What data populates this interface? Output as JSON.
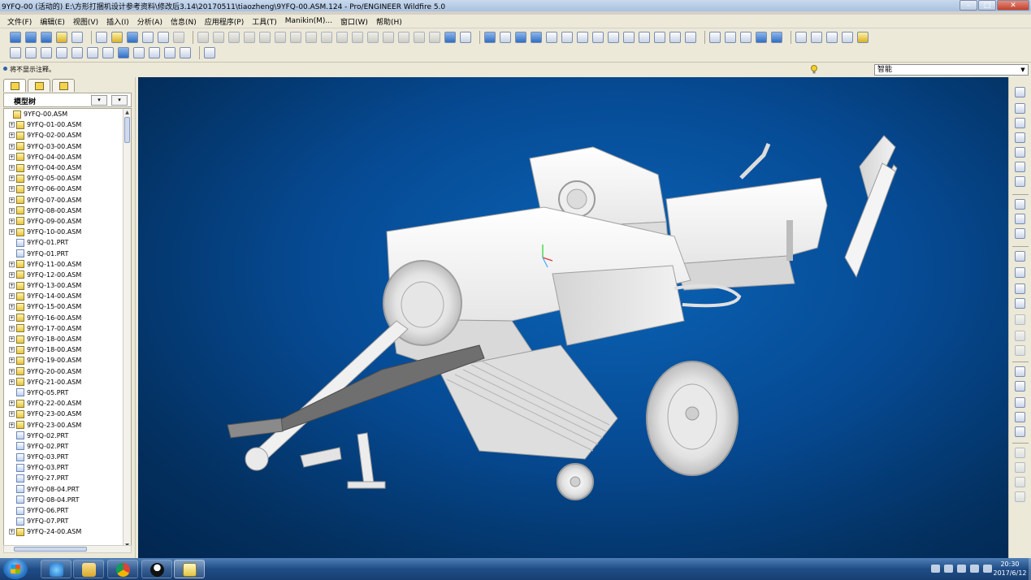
{
  "window": {
    "title": "9YFQ-00 (活动的) E:\\方形打捆机设计参考资料\\修改后3.14\\20170511\\tiaozheng\\9YFQ-00.ASM.124 - Pro/ENGINEER Wildfire 5.0",
    "minimize_glyph": "–",
    "maximize_glyph": "□",
    "close_glyph": "✕"
  },
  "menu": [
    "文件(F)",
    "编辑(E)",
    "视图(V)",
    "插入(I)",
    "分析(A)",
    "信息(N)",
    "应用程序(P)",
    "工具(T)",
    "Manikin(M)...",
    "窗口(W)",
    "帮助(H)"
  ],
  "message_line": {
    "text": "将不显示注释。",
    "filter_value": "智能"
  },
  "panel": {
    "title": "模型树"
  },
  "model_tree": [
    {
      "label": "9YFQ-00.ASM",
      "type": "asm",
      "expandable": false,
      "root": true
    },
    {
      "label": "9YFQ-01-00.ASM",
      "type": "asm",
      "expandable": true
    },
    {
      "label": "9YFQ-02-00.ASM",
      "type": "asm",
      "expandable": true
    },
    {
      "label": "9YFQ-03-00.ASM",
      "type": "asm",
      "expandable": true
    },
    {
      "label": "9YFQ-04-00.ASM",
      "type": "asm",
      "expandable": true
    },
    {
      "label": "9YFQ-04-00.ASM",
      "type": "asm",
      "expandable": true
    },
    {
      "label": "9YFQ-05-00.ASM",
      "type": "asm",
      "expandable": true
    },
    {
      "label": "9YFQ-06-00.ASM",
      "type": "asm",
      "expandable": true
    },
    {
      "label": "9YFQ-07-00.ASM",
      "type": "asm",
      "expandable": true
    },
    {
      "label": "9YFQ-08-00.ASM",
      "type": "asm",
      "expandable": true
    },
    {
      "label": "9YFQ-09-00.ASM",
      "type": "asm",
      "expandable": true
    },
    {
      "label": "9YFQ-10-00.ASM",
      "type": "asm",
      "expandable": true
    },
    {
      "label": "9YFQ-01.PRT",
      "type": "prt",
      "expandable": false
    },
    {
      "label": "9YFQ-01.PRT",
      "type": "prt",
      "expandable": false
    },
    {
      "label": "9YFQ-11-00.ASM",
      "type": "asm",
      "expandable": true
    },
    {
      "label": "9YFQ-12-00.ASM",
      "type": "asm",
      "expandable": true
    },
    {
      "label": "9YFQ-13-00.ASM",
      "type": "asm",
      "expandable": true
    },
    {
      "label": "9YFQ-14-00.ASM",
      "type": "asm",
      "expandable": true
    },
    {
      "label": "9YFQ-15-00.ASM",
      "type": "asm",
      "expandable": true
    },
    {
      "label": "9YFQ-16-00.ASM",
      "type": "asm",
      "expandable": true
    },
    {
      "label": "9YFQ-17-00.ASM",
      "type": "asm",
      "expandable": true
    },
    {
      "label": "9YFQ-18-00.ASM",
      "type": "asm",
      "expandable": true
    },
    {
      "label": "9YFQ-18-00.ASM",
      "type": "asm",
      "expandable": true
    },
    {
      "label": "9YFQ-19-00.ASM",
      "type": "asm",
      "expandable": true
    },
    {
      "label": "9YFQ-20-00.ASM",
      "type": "asm",
      "expandable": true
    },
    {
      "label": "9YFQ-21-00.ASM",
      "type": "asm",
      "expandable": true
    },
    {
      "label": "9YFQ-05.PRT",
      "type": "prt",
      "expandable": false
    },
    {
      "label": "9YFQ-22-00.ASM",
      "type": "asm",
      "expandable": true
    },
    {
      "label": "9YFQ-23-00.ASM",
      "type": "asm",
      "expandable": true
    },
    {
      "label": "9YFQ-23-00.ASM",
      "type": "asm",
      "expandable": true
    },
    {
      "label": "9YFQ-02.PRT",
      "type": "prt",
      "expandable": false
    },
    {
      "label": "9YFQ-02.PRT",
      "type": "prt",
      "expandable": false
    },
    {
      "label": "9YFQ-03.PRT",
      "type": "prt",
      "expandable": false
    },
    {
      "label": "9YFQ-03.PRT",
      "type": "prt",
      "expandable": false
    },
    {
      "label": "9YFQ-27.PRT",
      "type": "prt",
      "expandable": false
    },
    {
      "label": "9YFQ-08-04.PRT",
      "type": "prt",
      "expandable": false
    },
    {
      "label": "9YFQ-08-04.PRT",
      "type": "prt",
      "expandable": false
    },
    {
      "label": "9YFQ-06.PRT",
      "type": "prt",
      "expandable": false
    },
    {
      "label": "9YFQ-07.PRT",
      "type": "prt",
      "expandable": false
    },
    {
      "label": "9YFQ-24-00.ASM",
      "type": "asm",
      "expandable": true
    }
  ],
  "taskbar": {
    "time": "20:30",
    "date": "2017/6/12"
  }
}
